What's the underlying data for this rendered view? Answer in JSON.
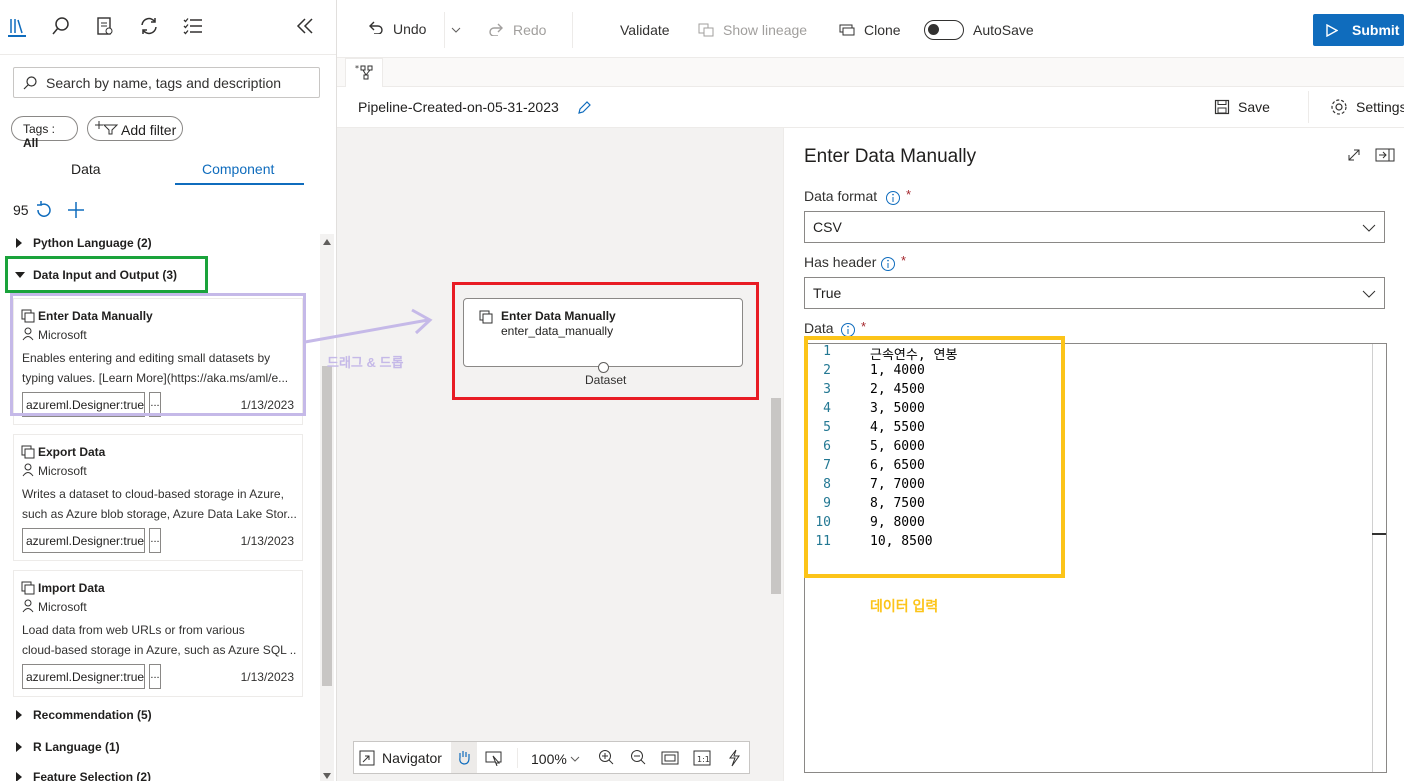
{
  "left_panel": {
    "search_placeholder": "Search by name, tags and description",
    "tags_filter": {
      "label": "Tags : ",
      "value": "All"
    },
    "add_filter": "Add filter",
    "tabs": [
      "Data",
      "Component"
    ],
    "active_tab": "Component",
    "count": "95",
    "categories": [
      {
        "label": "Python Language (2)",
        "expanded": false
      },
      {
        "label": "Data Input and Output (3)",
        "expanded": true
      },
      {
        "label": "Recommendation (5)",
        "expanded": false
      },
      {
        "label": "R Language (1)",
        "expanded": false
      },
      {
        "label": "Feature Selection (2)",
        "expanded": false
      }
    ],
    "components": [
      {
        "title": "Enter Data Manually",
        "publisher": "Microsoft",
        "desc1": "Enables entering and editing small datasets by",
        "desc2": "typing values. [Learn More](https://aka.ms/aml/e...",
        "tag": "azureml.Designer:true",
        "more": "...",
        "date": "1/13/2023"
      },
      {
        "title": "Export Data",
        "publisher": "Microsoft",
        "desc1": "Writes a dataset to cloud-based storage in Azure,",
        "desc2": "such as Azure blob storage, Azure Data Lake Stor...",
        "tag": "azureml.Designer:true",
        "more": "...",
        "date": "1/13/2023"
      },
      {
        "title": "Import Data",
        "publisher": "Microsoft",
        "desc1": "Load data from web URLs or from various",
        "desc2": "cloud-based storage in Azure, such as Azure SQL ...",
        "tag": "azureml.Designer:true",
        "more": "...",
        "date": "1/13/2023"
      }
    ]
  },
  "toolbar": {
    "undo": "Undo",
    "redo": "Redo",
    "validate": "Validate",
    "show_lineage": "Show lineage",
    "clone": "Clone",
    "autosave": "AutoSave",
    "submit": "Submit"
  },
  "pipeline": {
    "name": "Pipeline-Created-on-05-31-2023",
    "save": "Save",
    "settings": "Settings"
  },
  "canvas": {
    "annotation": "드래그 & 드롭",
    "node": {
      "title": "Enter Data Manually",
      "subtitle": "enter_data_manually",
      "port_label": "Dataset"
    },
    "navigator": {
      "label": "Navigator",
      "zoom": "100%"
    }
  },
  "properties": {
    "title": "Enter Data Manually",
    "data_format": {
      "label": "Data format",
      "value": "CSV"
    },
    "has_header": {
      "label": "Has header",
      "value": "True"
    },
    "data": {
      "label": "Data"
    },
    "lines": [
      "근속연수, 연봉",
      "1, 4000",
      "2, 4500",
      "3, 5000",
      "4, 5500",
      "5, 6000",
      "6, 6500",
      "7, 7000",
      "8, 7500",
      "9, 8000",
      "10, 8500"
    ],
    "annotation": "데이터 입력"
  },
  "colors": {
    "accent": "#0f6cbd",
    "green_box": "#1aa33b",
    "purple_box": "#c5b9e8",
    "red_box": "#e81c24",
    "yellow_box": "#fcc419"
  }
}
